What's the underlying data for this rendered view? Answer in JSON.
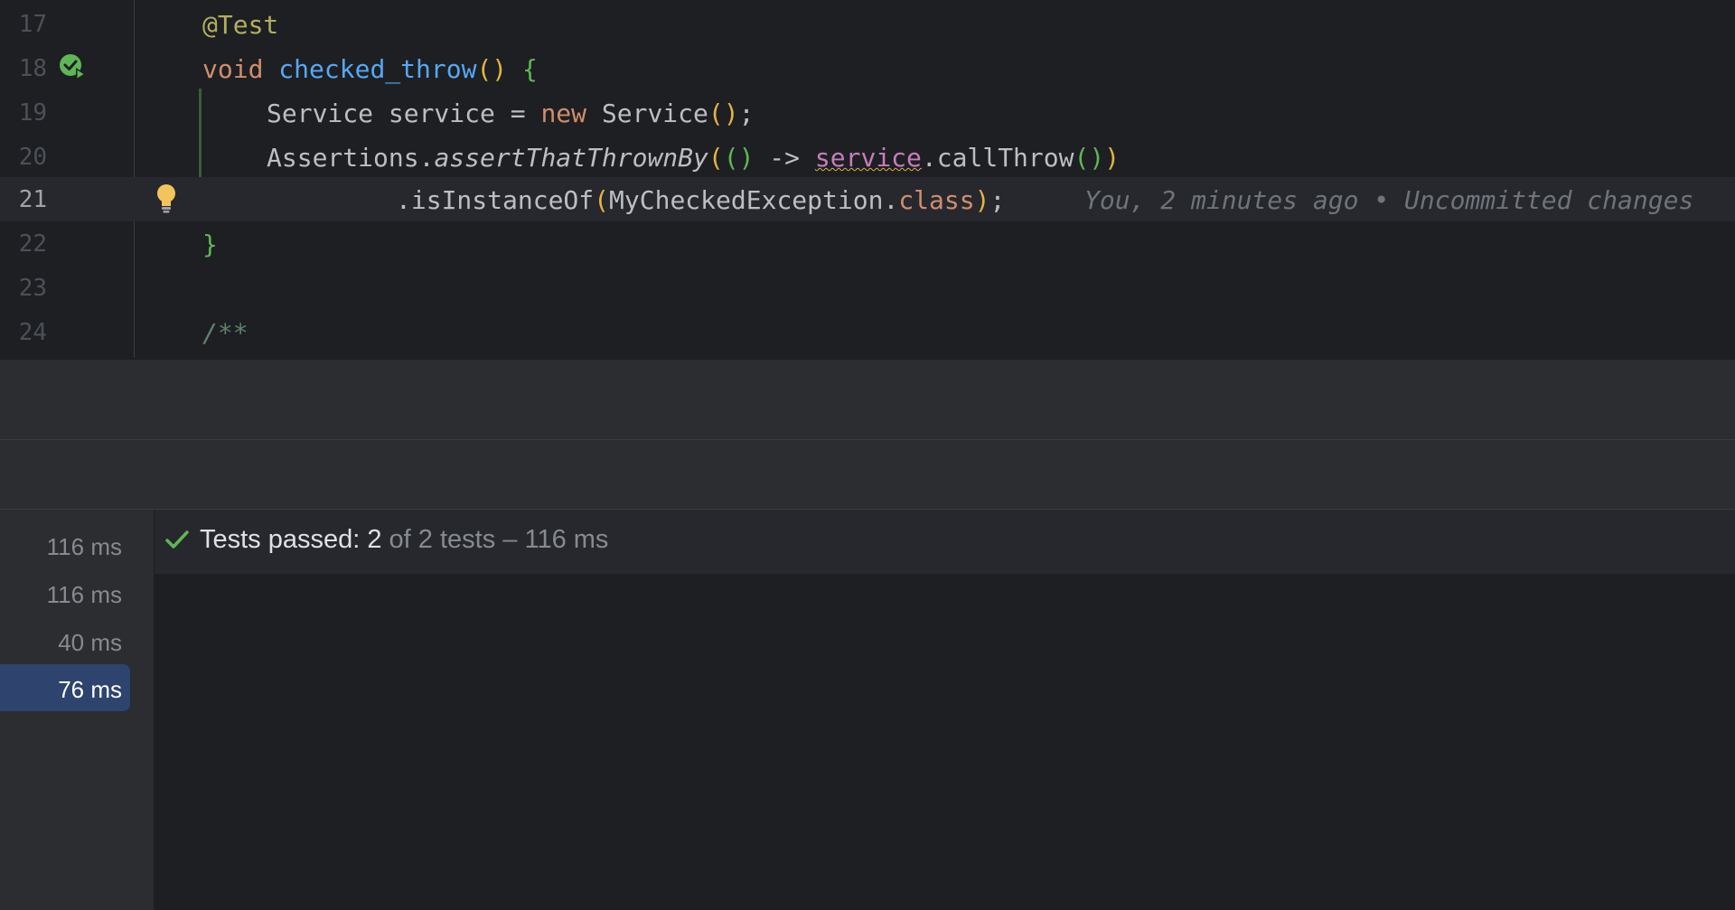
{
  "editor": {
    "lines": [
      {
        "number": "17",
        "tokens": [
          {
            "t": "@Test",
            "c": "ann"
          }
        ]
      },
      {
        "number": "18",
        "tokens": [
          {
            "t": "void ",
            "c": "kw"
          },
          {
            "t": "checked_throw",
            "c": "fn"
          },
          {
            "t": "() ",
            "c": "br1"
          },
          {
            "t": "{",
            "c": "br2"
          }
        ]
      },
      {
        "number": "19",
        "tokens": [
          {
            "t": "Service service = ",
            "c": ""
          },
          {
            "t": "new ",
            "c": "kw"
          },
          {
            "t": "Service",
            "c": ""
          },
          {
            "t": "()",
            "c": "br1"
          },
          {
            "t": ";",
            "c": ""
          }
        ]
      },
      {
        "number": "20",
        "tokens": [
          {
            "t": "Assertions.",
            "c": ""
          },
          {
            "t": "assertThatThrownBy",
            "c": "it"
          },
          {
            "t": "(",
            "c": "br1"
          },
          {
            "t": "()",
            "c": "br2"
          },
          {
            "t": " -> ",
            "c": ""
          },
          {
            "t": "service",
            "c": "pf"
          },
          {
            "t": ".callThrow",
            "c": ""
          },
          {
            "t": "()",
            "c": "br2"
          },
          {
            "t": ")",
            "c": "br1"
          }
        ]
      },
      {
        "number": "21",
        "tokens": [
          {
            "t": ".isInstanceOf",
            "c": ""
          },
          {
            "t": "(",
            "c": "br1"
          },
          {
            "t": "MyCheckedException.",
            "c": ""
          },
          {
            "t": "class",
            "c": "kw"
          },
          {
            "t": ")",
            "c": "br1"
          },
          {
            "t": ";",
            "c": ""
          }
        ]
      },
      {
        "number": "22",
        "tokens": [
          {
            "t": "}",
            "c": "br2"
          }
        ]
      },
      {
        "number": "23",
        "tokens": []
      },
      {
        "number": "24",
        "tokens": [
          {
            "t": "/**",
            "c": "cm"
          }
        ]
      }
    ],
    "blame": "You, 2 minutes ago • Uncommitted changes",
    "icons": {
      "run_gutter": "run-test-passed-icon",
      "intention": "lightbulb-icon"
    }
  },
  "test_tree": {
    "durations": [
      "116 ms",
      "116 ms",
      "40 ms",
      "76 ms"
    ],
    "selected_index": 3
  },
  "console": {
    "status_main": "Tests passed: 2",
    "status_sub": " of 2 tests – 116 ms",
    "icon": "check-icon"
  },
  "colors": {
    "accent_selection": "#2e436e",
    "success": "#5fb655"
  }
}
